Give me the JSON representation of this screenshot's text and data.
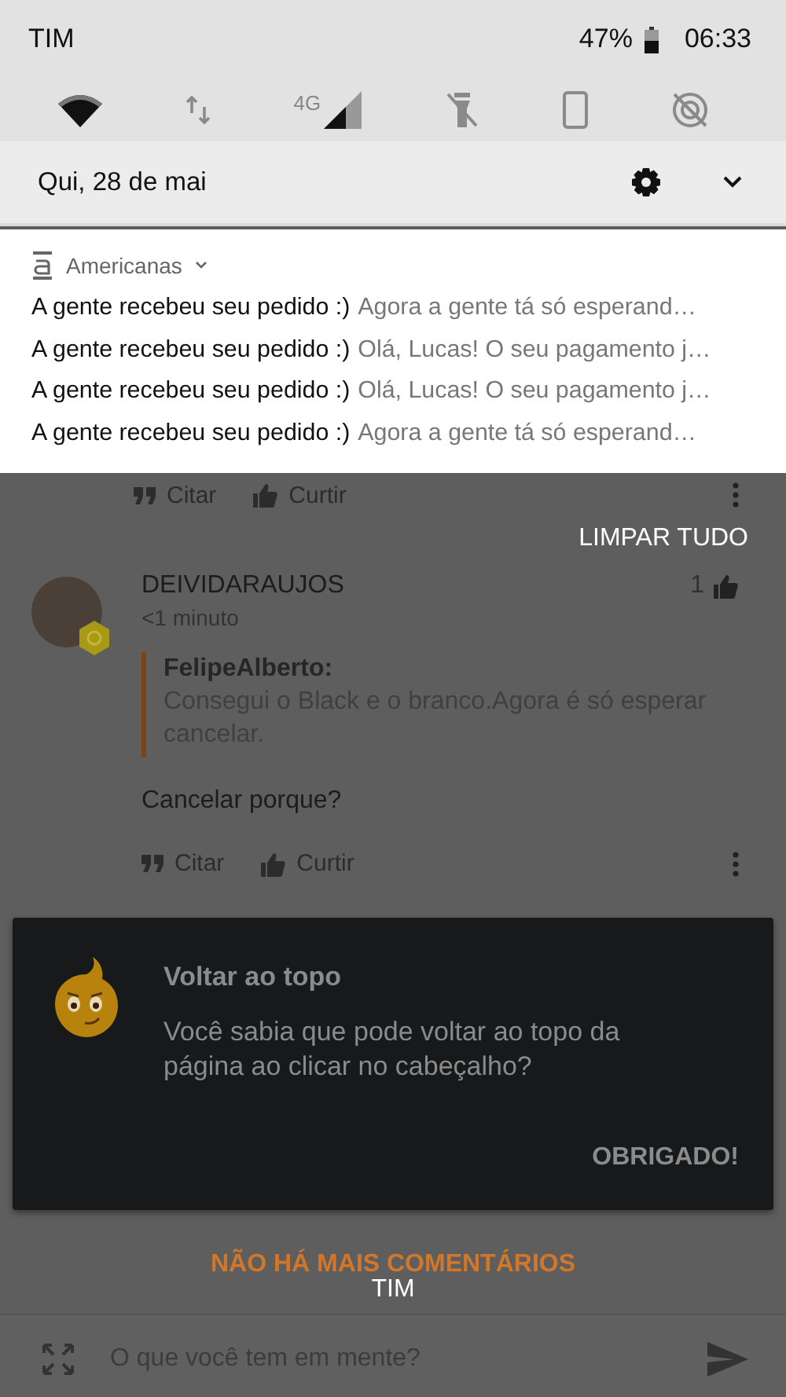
{
  "status_bar": {
    "carrier": "TIM",
    "battery": "47%",
    "time": "06:33"
  },
  "quick_tiles": [
    {
      "kind": "wifi",
      "on": true
    },
    {
      "kind": "data",
      "on": false
    },
    {
      "kind": "signal",
      "on": true,
      "label": "4G"
    },
    {
      "kind": "flashlight",
      "on": false
    },
    {
      "kind": "rotation",
      "on": false
    },
    {
      "kind": "location",
      "on": false
    }
  ],
  "shade_header": {
    "date": "Qui, 28 de mai"
  },
  "notification": {
    "app": "Americanas",
    "messages": [
      {
        "title": "A gente recebeu seu pedido :)",
        "text": "Agora a gente tá só esperand…"
      },
      {
        "title": "A gente recebeu seu pedido :)",
        "text": "Olá, Lucas! O seu pagamento j…"
      },
      {
        "title": "A gente recebeu seu pedido :)",
        "text": "Olá, Lucas! O seu pagamento j…"
      },
      {
        "title": "A gente recebeu seu pedido :)",
        "text": "Agora a gente tá só esperand…"
      }
    ]
  },
  "previous_actions": [
    "Citar",
    "Curtir"
  ],
  "clear_all": "LIMPAR TUDO",
  "comment": {
    "author": "DEIVIDARAUJOS",
    "time": "<1 minuto",
    "likes": "1",
    "quote": {
      "author": "FelipeAlberto:",
      "text": "Consegui o Black e o branco.Agora é só esperar cancelar."
    },
    "body": "Cancelar porque?",
    "actions": [
      "Citar",
      "Curtir"
    ]
  },
  "tip": {
    "title": "Voltar ao topo",
    "text": "Você sabia que pode voltar ao topo da página ao clicar no cabeçalho?",
    "button": "OBRIGADO!"
  },
  "end_label": "NÃO HÁ MAIS COMENTÁRIOS",
  "carrier_overlay": "TIM",
  "composer": {
    "placeholder": "O que você tem em mente?"
  }
}
